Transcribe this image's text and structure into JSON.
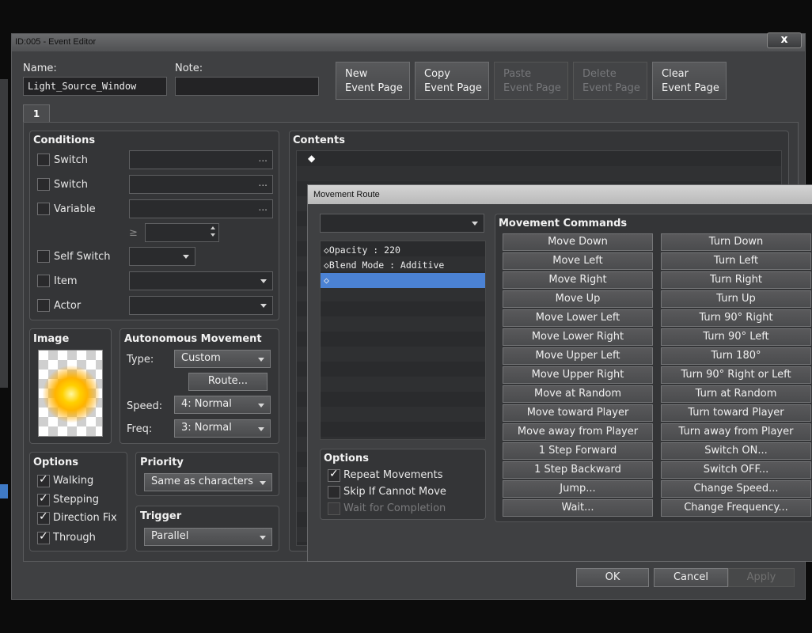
{
  "window": {
    "title": "ID:005 - Event Editor",
    "close": "x"
  },
  "name": {
    "label": "Name:",
    "value": "Light_Source_Window"
  },
  "note": {
    "label": "Note:",
    "value": ""
  },
  "event_buttons": [
    {
      "line1": "New",
      "line2": "Event Page",
      "disabled": false
    },
    {
      "line1": "Copy",
      "line2": "Event Page",
      "disabled": false
    },
    {
      "line1": "Paste",
      "line2": "Event Page",
      "disabled": true
    },
    {
      "line1": "Delete",
      "line2": "Event Page",
      "disabled": true
    },
    {
      "line1": "Clear",
      "line2": "Event Page",
      "disabled": false
    }
  ],
  "page_tab": "1",
  "conditions": {
    "title": "Conditions",
    "switch1": "Switch",
    "switch2": "Switch",
    "variable": "Variable",
    "ge": "≥",
    "self_switch": "Self Switch",
    "item": "Item",
    "actor": "Actor",
    "dots": "..."
  },
  "image": {
    "title": "Image"
  },
  "autonomous": {
    "title": "Autonomous Movement",
    "type_label": "Type:",
    "type_value": "Custom",
    "route_button": "Route...",
    "speed_label": "Speed:",
    "speed_value": "4: Normal",
    "freq_label": "Freq:",
    "freq_value": "3: Normal"
  },
  "options": {
    "title": "Options",
    "items": [
      "Walking",
      "Stepping",
      "Direction Fix",
      "Through"
    ]
  },
  "priority": {
    "title": "Priority",
    "value": "Same as characters"
  },
  "trigger": {
    "title": "Trigger",
    "value": "Parallel"
  },
  "contents": {
    "title": "Contents",
    "first_row": "◆"
  },
  "footer": {
    "ok": "OK",
    "cancel": "Cancel",
    "apply": "Apply"
  },
  "movement_route": {
    "title": "Movement Route",
    "list": [
      "◇Opacity : 220",
      "◇Blend Mode : Additive",
      "◇"
    ],
    "options_title": "Options",
    "opt_repeat": "Repeat Movements",
    "opt_skip": "Skip If Cannot Move",
    "opt_wait": "Wait for Completion",
    "commands_title": "Movement Commands",
    "left_commands": [
      "Move Down",
      "Move Left",
      "Move Right",
      "Move Up",
      "Move Lower Left",
      "Move Lower Right",
      "Move Upper Left",
      "Move Upper Right",
      "Move at Random",
      "Move toward Player",
      "Move away from Player",
      "1 Step Forward",
      "1 Step Backward",
      "Jump...",
      "Wait..."
    ],
    "right_commands": [
      "Turn Down",
      "Turn Left",
      "Turn Right",
      "Turn Up",
      "Turn 90° Right",
      "Turn 90° Left",
      "Turn 180°",
      "Turn 90° Right or Left",
      "Turn at Random",
      "Turn toward Player",
      "Turn away from Player",
      "Switch ON...",
      "Switch OFF...",
      "Change Speed...",
      "Change Frequency..."
    ]
  },
  "colors": {
    "selection": "#4b82d4",
    "accent_glow": "#ffb300"
  }
}
